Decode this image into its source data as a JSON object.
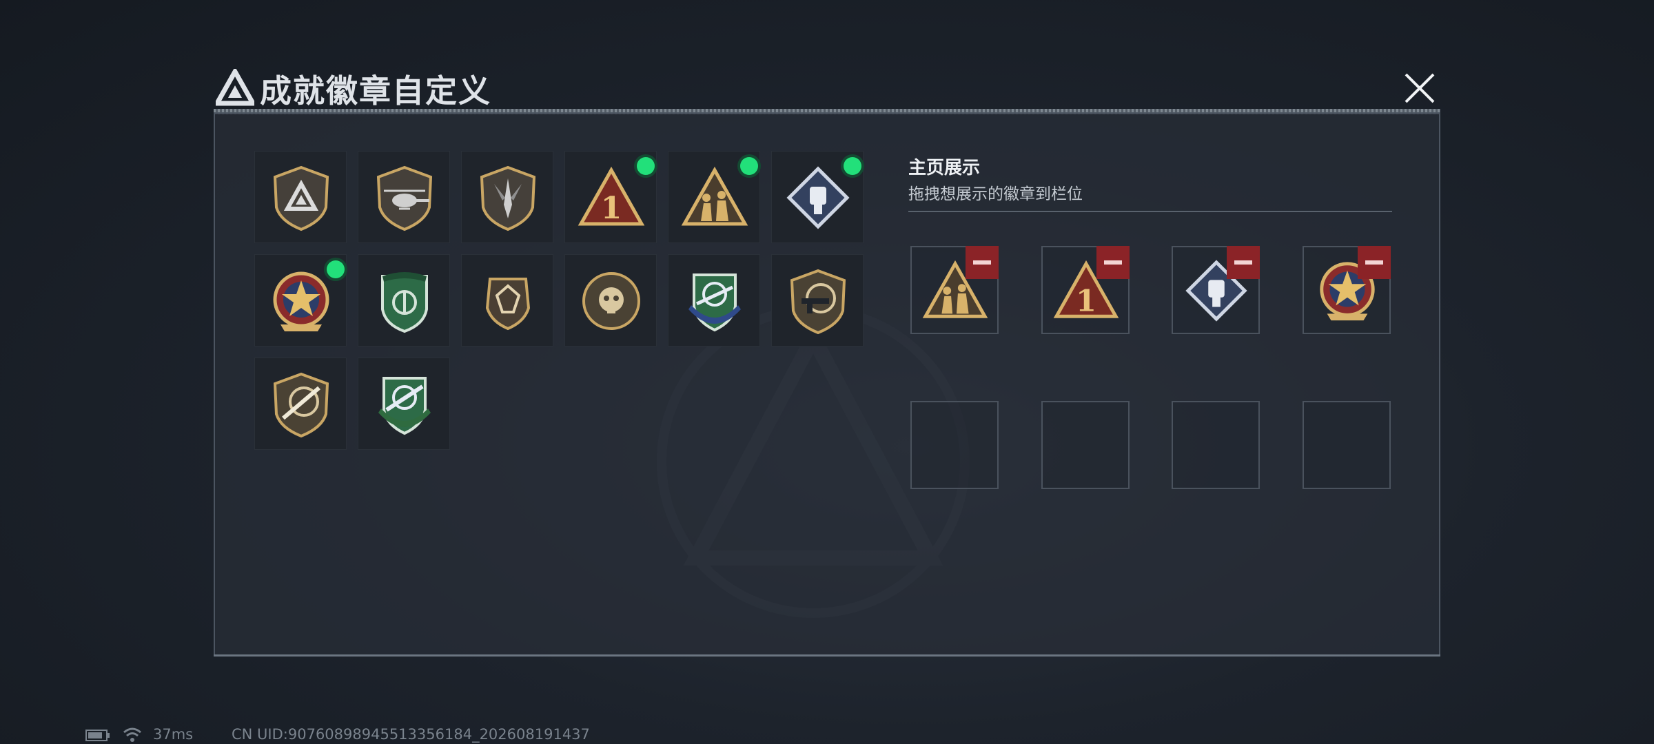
{
  "window": {
    "title": "成就徽章自定义"
  },
  "collection": {
    "badges": [
      {
        "name": "delta-shield-badge",
        "new": false
      },
      {
        "name": "helicopter-shield-badge",
        "new": false
      },
      {
        "name": "dagger-shield-badge",
        "new": false
      },
      {
        "name": "number-one-triangle-badge",
        "new": true
      },
      {
        "name": "soldiers-triangle-badge",
        "new": true
      },
      {
        "name": "fist-diamond-badge",
        "new": true
      },
      {
        "name": "star-crest-badge",
        "new": true
      },
      {
        "name": "green-winged-shield-badge",
        "new": false
      },
      {
        "name": "gem-shield-badge",
        "new": false
      },
      {
        "name": "skull-crest-badge",
        "new": false
      },
      {
        "name": "blue-rifle-shield-badge",
        "new": false
      },
      {
        "name": "smg-shield-badge",
        "new": false
      },
      {
        "name": "sniper-shield-badge",
        "new": false
      },
      {
        "name": "green-rifle-crest-badge",
        "new": false
      }
    ]
  },
  "showcase": {
    "title": "主页展示",
    "subtitle": "拖拽想展示的徽章到栏位",
    "slots": [
      {
        "badge": "soldiers-triangle-badge"
      },
      {
        "badge": "number-one-triangle-badge"
      },
      {
        "badge": "fist-diamond-badge"
      },
      {
        "badge": "star-crest-badge"
      },
      {
        "badge": ""
      },
      {
        "badge": ""
      },
      {
        "badge": ""
      },
      {
        "badge": ""
      }
    ]
  },
  "status_bar": {
    "ping": "37ms",
    "uid": "CN UID:907608989455133561­84_202608191437"
  },
  "colors": {
    "new_indicator": "#22e07a",
    "remove_button": "#8b2327",
    "gold": "#c9a664"
  }
}
